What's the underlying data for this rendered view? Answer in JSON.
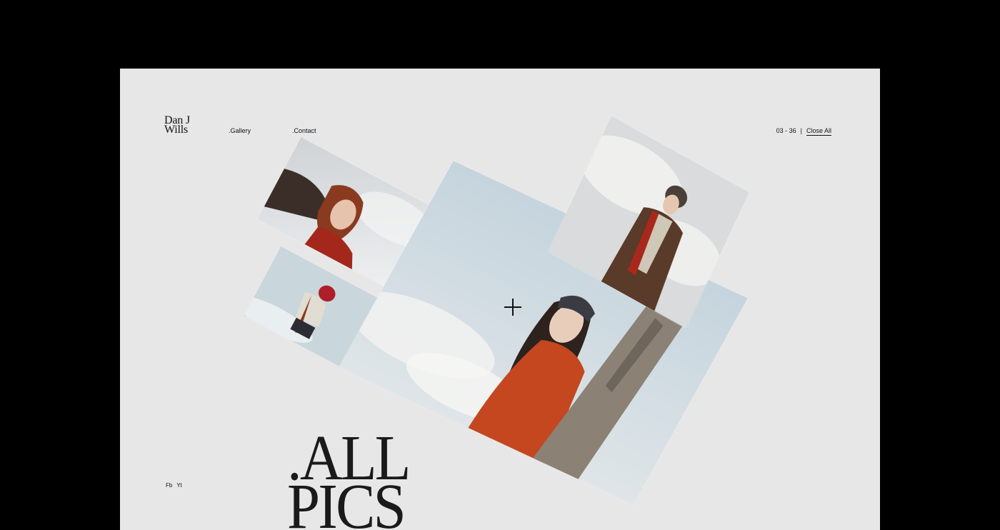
{
  "header": {
    "logo_line1": "Dan J",
    "logo_line2": "Wills",
    "nav": {
      "gallery": ".Gallery",
      "contact": ".Contact"
    },
    "counter": "03 - 36",
    "separator": "|",
    "close_all": "Close All"
  },
  "social": {
    "fb": "Fb",
    "yt": "Yt"
  },
  "title": {
    "line1": ".ALL",
    "line2": "PICS"
  },
  "colors": {
    "page_bg": "#e7e7e7",
    "outer_bg": "#000000",
    "text": "#111111",
    "accent_sweater": "#c4471f"
  }
}
